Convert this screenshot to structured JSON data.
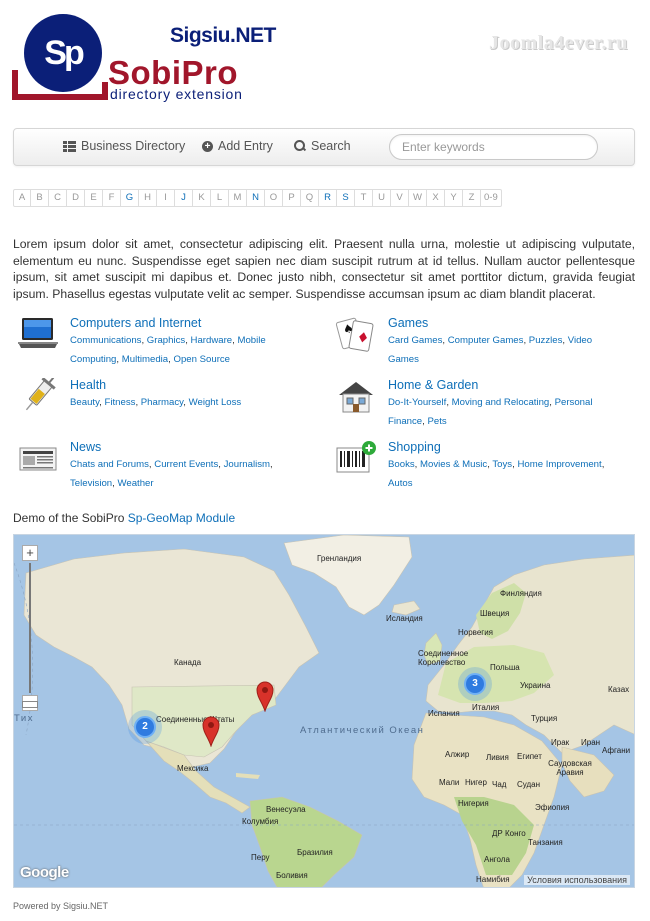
{
  "header": {
    "logo_initials": "Sp",
    "logo_brand": "Sigsiu.NET",
    "logo_name": "SobiPro",
    "logo_tagline": "directory extension",
    "watermark": "Joomla4ever.ru"
  },
  "nav": {
    "items": [
      {
        "label": "Business Directory",
        "icon": "list-icon"
      },
      {
        "label": "Add Entry",
        "icon": "plus-circle-icon"
      },
      {
        "label": "Search",
        "icon": "search-icon"
      }
    ],
    "search_placeholder": "Enter keywords"
  },
  "alphabet": [
    "A",
    "B",
    "C",
    "D",
    "E",
    "F",
    "G",
    "H",
    "I",
    "J",
    "K",
    "L",
    "M",
    "N",
    "O",
    "P",
    "Q",
    "R",
    "S",
    "T",
    "U",
    "V",
    "W",
    "X",
    "Y",
    "Z",
    "0-9"
  ],
  "alphabet_active": [
    "G",
    "J",
    "N",
    "R",
    "S"
  ],
  "intro": "Lorem ipsum dolor sit amet, consectetur adipiscing elit. Praesent nulla urna, molestie ut adipiscing vulputate, elementum eu nunc. Suspendisse eget sapien nec diam suscipit rutrum at id tellus. Nullam auctor pellentesque ipsum, sit amet suscipit mi dapibus et. Donec justo nibh, consectetur sit amet porttitor dictum, gravida feugiat ipsum. Phasellus egestas vulputate velit ac semper. Suspendisse accumsan ipsum ac diam blandit placerat.",
  "categories": [
    {
      "title": "Computers and Internet",
      "icon": "laptop-icon",
      "subs": [
        "Communications",
        "Graphics",
        "Hardware",
        "Mobile Computing",
        "Multimedia",
        "Open Source"
      ]
    },
    {
      "title": "Games",
      "icon": "playing-cards-icon",
      "subs": [
        "Card Games",
        "Computer Games",
        "Puzzles",
        "Video Games"
      ]
    },
    {
      "title": "Health",
      "icon": "syringe-icon",
      "subs": [
        "Beauty",
        "Fitness",
        "Pharmacy",
        "Weight Loss"
      ]
    },
    {
      "title": "Home & Garden",
      "icon": "house-icon",
      "subs": [
        "Do-It-Yourself",
        "Moving and Relocating",
        "Personal Finance",
        "Pets"
      ]
    },
    {
      "title": "News",
      "icon": "newspaper-icon",
      "subs": [
        "Chats and Forums",
        "Current Events",
        "Journalism",
        "Television",
        "Weather"
      ]
    },
    {
      "title": "Shopping",
      "icon": "barcode-icon",
      "subs": [
        "Books",
        "Movies & Music",
        "Toys",
        "Home Improvement",
        "Autos"
      ]
    }
  ],
  "map": {
    "caption_prefix": "Demo of the SobiPro",
    "caption_link": "Sp-GeoMap Module",
    "zoom_in": "+",
    "zoom_out": "−",
    "clusters": [
      "2",
      "3"
    ],
    "labels": {
      "greenland": "Гренландия",
      "iceland": "Исландия",
      "canada": "Канада",
      "usa": "Соединенные Штаты",
      "mexico": "Мексика",
      "venezuela": "Венесуэла",
      "colombia": "Колумбия",
      "peru": "Перу",
      "brazil": "Бразилия",
      "bolivia": "Боливия",
      "finland": "Финляндия",
      "sweden": "Швеция",
      "norway": "Норвегия",
      "uk": "Соединенное Королевство",
      "poland": "Польша",
      "ukraine": "Украина",
      "spain": "Испания",
      "italy": "Италия",
      "turkey": "Турция",
      "kazakhstan": "Казах",
      "iraq": "Ирак",
      "iran": "Иран",
      "afghanistan": "Афгани",
      "algeria": "Алжир",
      "libya": "Ливия",
      "egypt": "Египет",
      "saudi": "Саудовская Аравия",
      "mali": "Мали",
      "niger": "Нигер",
      "chad": "Чад",
      "sudan": "Судан",
      "nigeria": "Нигерия",
      "ethiopia": "Эфиопия",
      "drc": "ДР Конго",
      "tanzania": "Танзания",
      "angola": "Ангола",
      "namibia": "Намибия",
      "atlantic": "Атлантический Океан",
      "pacific_fragment": "Тихий Океан"
    },
    "google": "Google",
    "terms": "Условия использования"
  },
  "footer": "Powered by Sigsiu.NET"
}
